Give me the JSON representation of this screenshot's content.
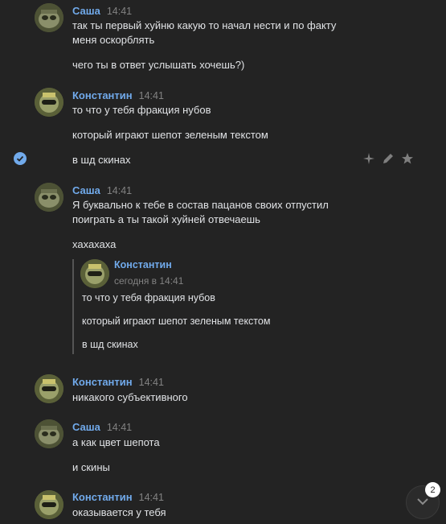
{
  "messages": [
    {
      "author": "Саша",
      "time": "14:41",
      "avatar": "sasha",
      "lines": [
        "так ты первый хуйню какую то начал нести и по факту",
        "меня оскорблять",
        "чего ты в ответ услышать хочешь?)"
      ]
    },
    {
      "author": "Константин",
      "time": "14:41",
      "avatar": "konstantin",
      "lines": [
        "то что у тебя фракция нубов",
        "который играют шепот зеленым текстом",
        "в шд скинах"
      ]
    },
    {
      "author": "Саша",
      "time": "14:41",
      "avatar": "sasha",
      "lines": [
        "Я буквально к тебе в состав пацанов своих отпустил",
        "поиграть а ты такой хуйней отвечаешь",
        "хахахаха"
      ],
      "reply": {
        "author": "Константин",
        "date": "сегодня в 14:41",
        "lines": [
          "то что у тебя фракция нубов",
          "который играют шепот зеленым текстом",
          "в шд скинах"
        ]
      }
    },
    {
      "author": "Константин",
      "time": "14:41",
      "avatar": "konstantin",
      "lines": [
        "никакого субъективного"
      ]
    },
    {
      "author": "Саша",
      "time": "14:41",
      "avatar": "sasha",
      "lines": [
        "а как цвет шепота",
        "и скины"
      ]
    },
    {
      "author": "Константин",
      "time": "14:41",
      "avatar": "konstantin",
      "lines": [
        "оказывается у тебя"
      ]
    }
  ],
  "actions": [
    {
      "icon": "sparkle-icon"
    },
    {
      "icon": "pencil-icon"
    },
    {
      "icon": "star-icon"
    }
  ],
  "selected_icon": "checkmark-icon",
  "scroll_button": {
    "icon": "chevron-down-icon",
    "badge": "2"
  },
  "colors": {
    "background": "#232323",
    "author": "#71aaeb",
    "text": "#e1e3e6",
    "muted": "#828282"
  }
}
